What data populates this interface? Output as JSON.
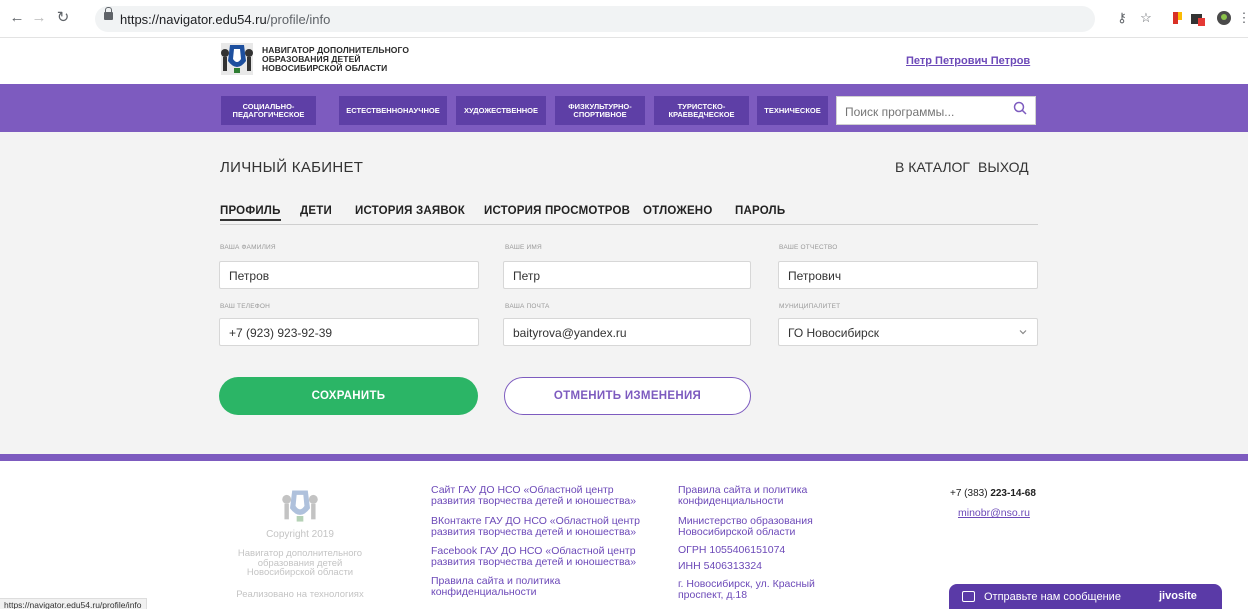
{
  "browser": {
    "url_domain": "https://navigator.edu54.ru",
    "url_path": "/profile/info"
  },
  "header": {
    "logo_lines": [
      "НАВИГАТОР ДОПОЛНИТЕЛЬНОГО",
      "ОБРАЗОВАНИЯ ДЕТЕЙ",
      "НОВОСИБИРСКОЙ ОБЛАСТИ"
    ],
    "user_name": "Петр Петрович Петров"
  },
  "categories": [
    {
      "line1": "СОЦИАЛЬНО-",
      "line2": "ПЕДАГОГИЧЕСКОЕ"
    },
    {
      "line1": "ЕСТЕСТВЕННОНАУЧНОЕ",
      "line2": ""
    },
    {
      "line1": "ХУДОЖЕСТВЕННОЕ",
      "line2": ""
    },
    {
      "line1": "ФИЗКУЛЬТУРНО-",
      "line2": "СПОРТИВНОЕ"
    },
    {
      "line1": "ТУРИСТСКО-",
      "line2": "КРАЕВЕДЧЕСКОЕ"
    },
    {
      "line1": "ТЕХНИЧЕСКОЕ",
      "line2": ""
    }
  ],
  "search": {
    "placeholder": "Поиск программы..."
  },
  "cabinet": {
    "title": "ЛИЧНЫЙ КАБИНЕТ",
    "catalog_link": "В КАТАЛОГ",
    "logout_link": "ВЫХОД"
  },
  "tabs": [
    {
      "label": "ПРОФИЛЬ",
      "active": true
    },
    {
      "label": "ДЕТИ",
      "active": false
    },
    {
      "label": "ИСТОРИЯ ЗАЯВОК",
      "active": false
    },
    {
      "label": "ИСТОРИЯ ПРОСМОТРОВ",
      "active": false
    },
    {
      "label": "ОТЛОЖЕНО",
      "active": false
    },
    {
      "label": "ПАРОЛЬ",
      "active": false
    }
  ],
  "form": {
    "surname": {
      "label": "ВАША ФАМИЛИЯ",
      "value": "Петров"
    },
    "name": {
      "label": "ВАШЕ ИМЯ",
      "value": "Петр"
    },
    "patronymic": {
      "label": "ВАШЕ ОТЧЕСТВО",
      "value": "Петрович"
    },
    "phone": {
      "label": "ВАШ ТЕЛЕФОН",
      "value": "+7 (923) 923-92-39"
    },
    "email": {
      "label": "ВАША ПОЧТА",
      "value": "baityrova@yandex.ru"
    },
    "municipality": {
      "label": "МУНИЦИПАЛИТЕТ",
      "value": "ГО Новосибирск"
    },
    "save_label": "СОХРАНИТЬ",
    "cancel_label": "ОТМЕНИТЬ ИЗМЕНЕНИЯ"
  },
  "footer": {
    "copyright": "Copyright 2019",
    "org_lines": [
      "Навигатор дополнительного",
      "образования детей",
      "Новосибирской области"
    ],
    "tech": "Реализовано на технологиях",
    "links_col1": [
      [
        "Сайт ГАУ ДО НСО «Областной центр",
        "развития творчества детей и юношества»"
      ],
      [
        "ВКонтакте ГАУ ДО НСО «Областной центр",
        "развития творчества детей и юношества»"
      ],
      [
        "Facebook ГАУ ДО НСО «Областной центр",
        "развития творчества детей и юношества»"
      ],
      [
        "Правила сайта и политика",
        "конфиденциальности"
      ]
    ],
    "links_col2": [
      [
        "Правила сайта и политика",
        "конфиденциальности"
      ],
      [
        "Министерство образования",
        "Новосибирской области"
      ]
    ],
    "ogrn": "ОГРН 1055406151074",
    "inn": "ИНН 5406313324",
    "address": [
      "г. Новосибирск, ул. Красный",
      "проспект, д.18"
    ],
    "phone_prefix": "+7 (383) ",
    "phone_number": "223-14-68",
    "email": "minobr@nso.ru"
  },
  "status_url": "https://navigator.edu54.ru/profile/info",
  "chat": {
    "text": "Отправьте нам сообщение",
    "brand": "jivosite"
  },
  "colors": {
    "purple": "#7d5bbf",
    "dark_purple": "#5e3fa6",
    "green": "#2bb566"
  }
}
